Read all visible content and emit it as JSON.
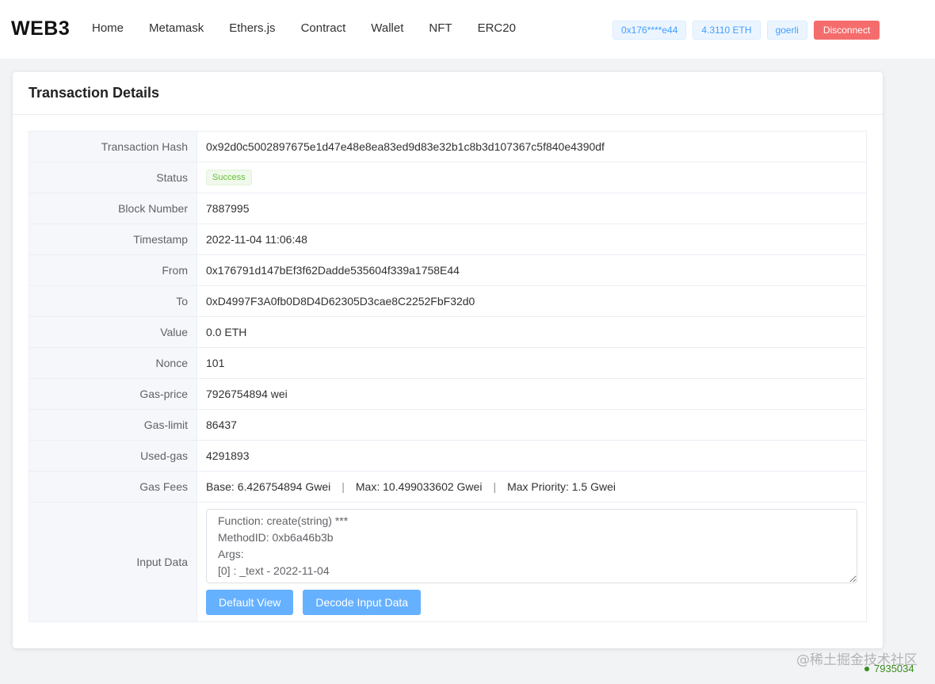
{
  "header": {
    "logo": "WEB3",
    "nav": [
      "Home",
      "Metamask",
      "Ethers.js",
      "Contract",
      "Wallet",
      "NFT",
      "ERC20"
    ],
    "account": "0x176****e44",
    "balance": "4.3110 ETH",
    "network": "goerli",
    "disconnect_label": "Disconnect"
  },
  "card": {
    "title": "Transaction Details",
    "rows": {
      "hash": {
        "label": "Transaction Hash",
        "value": "0x92d0c5002897675e1d47e48e8ea83ed9d83e32b1c8b3d107367c5f840e4390df"
      },
      "status": {
        "label": "Status",
        "value": "Success"
      },
      "block": {
        "label": "Block Number",
        "value": "7887995"
      },
      "timestamp": {
        "label": "Timestamp",
        "value": "2022-11-04 11:06:48"
      },
      "from": {
        "label": "From",
        "value": "0x176791d147bEf3f62Dadde535604f339a1758E44"
      },
      "to": {
        "label": "To",
        "value": "0xD4997F3A0fb0D8D4D62305D3cae8C2252FbF32d0"
      },
      "value": {
        "label": "Value",
        "value": "0.0 ETH"
      },
      "nonce": {
        "label": "Nonce",
        "value": "101"
      },
      "gas_price": {
        "label": "Gas-price",
        "value": "7926754894 wei"
      },
      "gas_limit": {
        "label": "Gas-limit",
        "value": "86437"
      },
      "used_gas": {
        "label": "Used-gas",
        "value": "4291893"
      },
      "gas_fees": {
        "label": "Gas Fees",
        "base": "Base: 6.426754894 Gwei",
        "max": "Max: 10.499033602 Gwei",
        "priority": "Max Priority: 1.5 Gwei",
        "separator": "|"
      },
      "input": {
        "label": "Input Data",
        "value": "Function: create(string) ***\nMethodID: 0xb6a46b3b\nArgs:\n[0] : _text - 2022-11-04",
        "default_view_label": "Default View",
        "decode_label": "Decode Input Data"
      }
    }
  },
  "watermark": "@稀土掘金技术社区",
  "counter": "7935034",
  "colors": {
    "primary": "#409eff",
    "success": "#67c23a",
    "danger": "#f56c6c"
  }
}
